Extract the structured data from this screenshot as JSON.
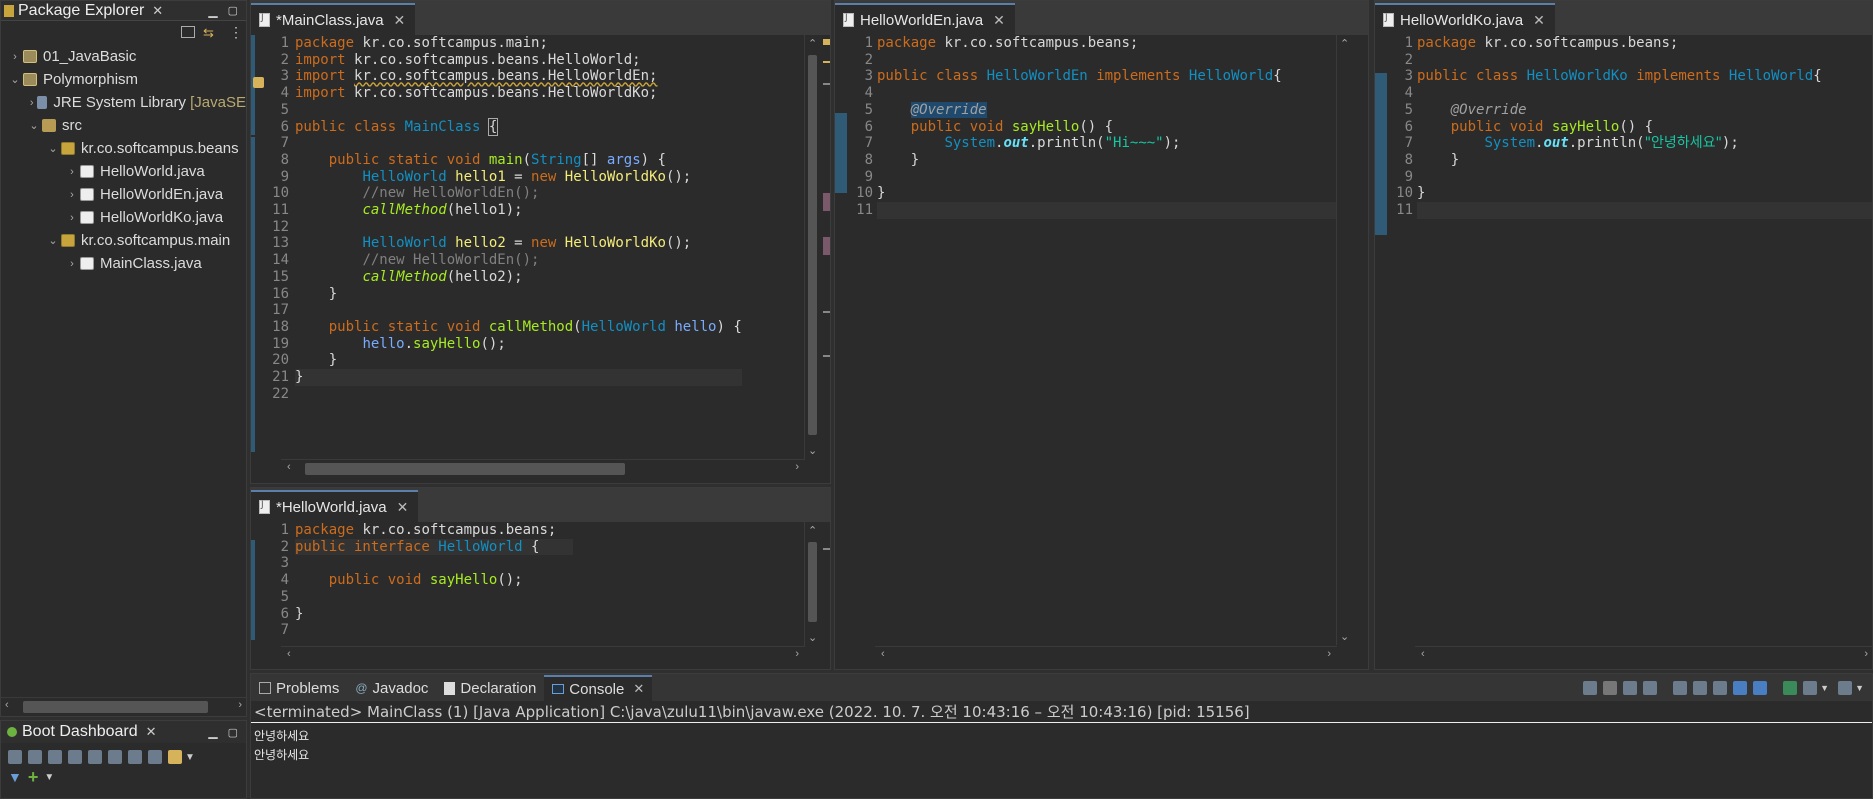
{
  "explorer": {
    "title": "Package Explorer",
    "items": [
      {
        "label": "01_JavaBasic",
        "extra": ""
      },
      {
        "label": "Polymorphism",
        "extra": ""
      },
      {
        "label": "JRE System Library",
        "extra": "[JavaSE"
      },
      {
        "label": "src",
        "extra": ""
      },
      {
        "label": "kr.co.softcampus.beans",
        "extra": ""
      },
      {
        "label": "HelloWorld.java",
        "extra": ""
      },
      {
        "label": "HelloWorldEn.java",
        "extra": ""
      },
      {
        "label": "HelloWorldKo.java",
        "extra": ""
      },
      {
        "label": "kr.co.softcampus.main",
        "extra": ""
      },
      {
        "label": "MainClass.java",
        "extra": ""
      }
    ]
  },
  "boot": {
    "title": "Boot Dashboard"
  },
  "editors": {
    "main": {
      "tab": "*MainClass.java",
      "close": "✕"
    },
    "en": {
      "tab": "HelloWorldEn.java",
      "close": "✕"
    },
    "ko": {
      "tab": "HelloWorldKo.java",
      "close": "✕"
    },
    "hw": {
      "tab": "*HelloWorld.java",
      "close": "✕"
    }
  },
  "main_lines": [
    "1",
    "2",
    "3",
    "4",
    "5",
    "6",
    "7",
    "8",
    "9",
    "10",
    "11",
    "12",
    "13",
    "14",
    "15",
    "16",
    "17",
    "18",
    "19",
    "20",
    "21",
    "22"
  ],
  "en_lines": [
    "1",
    "2",
    "3",
    "4",
    "5",
    "6",
    "7",
    "8",
    "9",
    "10",
    "11"
  ],
  "ko_lines": [
    "1",
    "2",
    "3",
    "4",
    "5",
    "6",
    "7",
    "8",
    "9",
    "10",
    "11"
  ],
  "hw_lines": [
    "1",
    "2",
    "3",
    "4",
    "5",
    "6",
    "7"
  ],
  "code": {
    "pkg_main": "kr.co.softcampus.main;",
    "imp1": "kr.co.softcampus.beans.HelloWorld;",
    "imp2": "kr.co.softcampus.beans.HelloWorldEn;",
    "imp3": "kr.co.softcampus.beans.HelloWorldKo;",
    "pkg_beans": "kr.co.softcampus.beans;",
    "str_hi": "\"Hi~~~\"",
    "str_ko": "\"안녕하세요\"",
    "comment_en": "//new HelloWorldEn();"
  },
  "console": {
    "tabs": [
      "Problems",
      "Javadoc",
      "Declaration",
      "Console"
    ],
    "status": "<terminated> MainClass (1) [Java Application] C:\\java\\zulu11\\bin\\javaw.exe  (2022. 10. 7. 오전 10:43:16 – 오전 10:43:16) [pid: 15156]",
    "output": [
      "안녕하세요",
      "안녕하세요"
    ]
  },
  "colors": {
    "bg": "#2b2b2b",
    "keyword": "#cc6c1d",
    "type": "#1290c3",
    "method": "#a7ec21",
    "string": "#17c6a3"
  }
}
